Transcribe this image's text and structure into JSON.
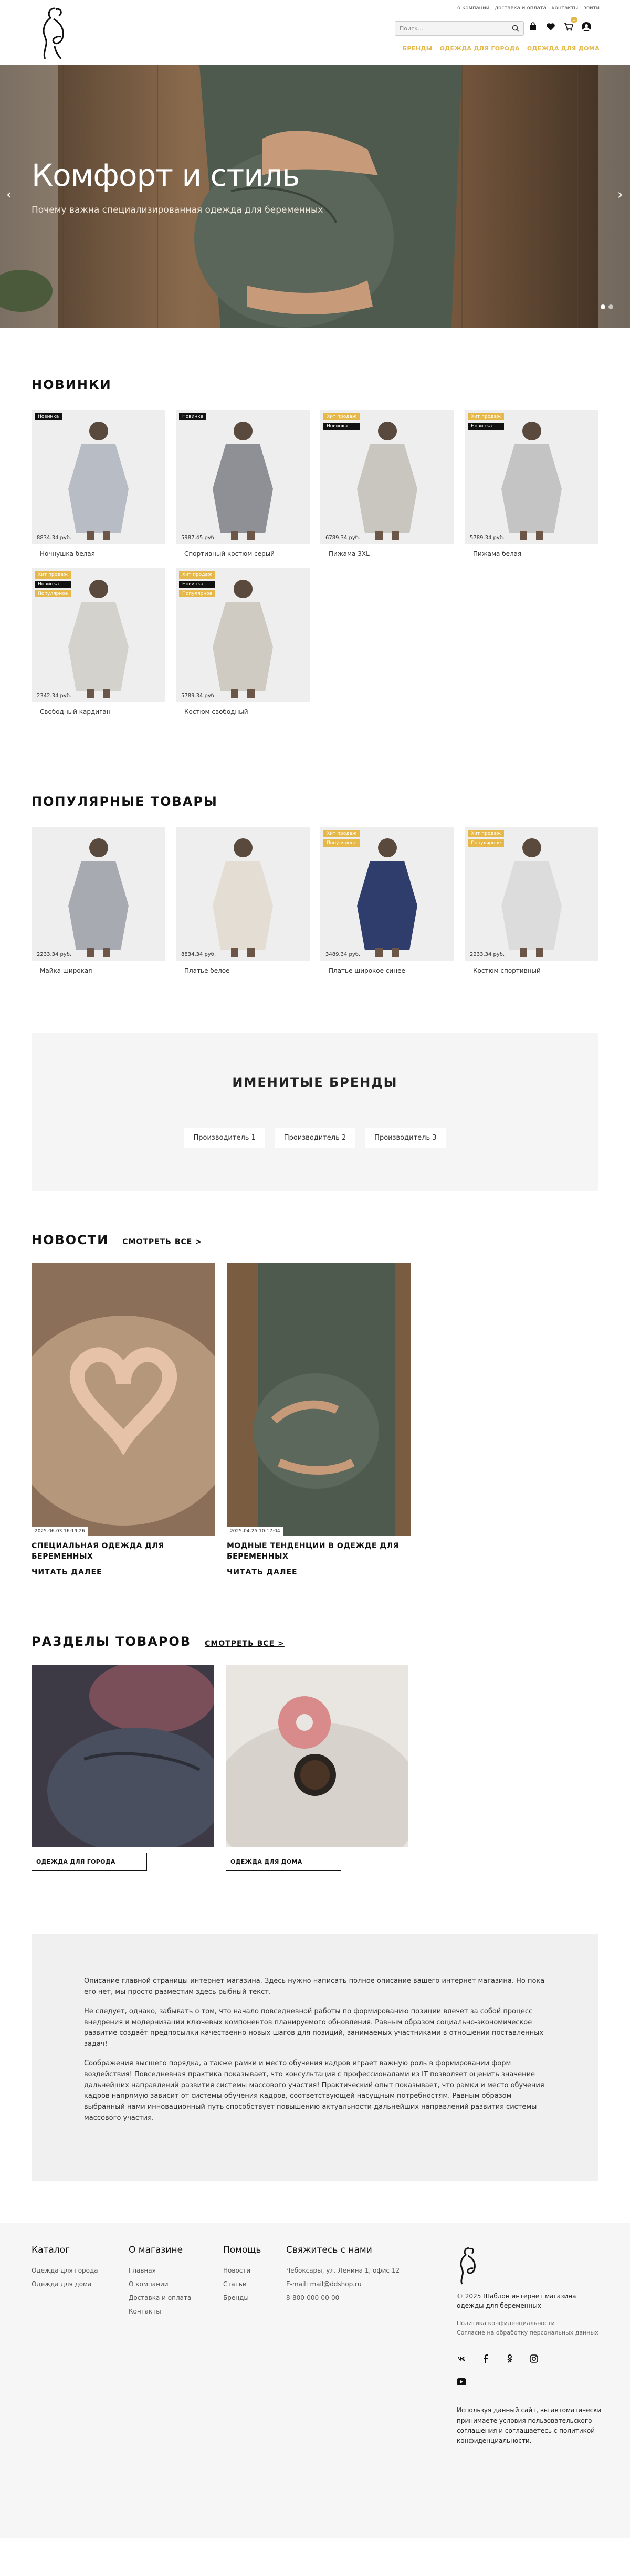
{
  "header": {
    "toplinks": [
      "о компании",
      "доставка и оплата",
      "контакты",
      "войти"
    ],
    "search_placeholder": "Поиск...",
    "cart_count": "1",
    "nav": [
      "БРЕНДЫ",
      "ОДЕЖДА ДЛЯ ГОРОДА",
      "ОДЕЖДА ДЛЯ ДОМА"
    ]
  },
  "hero": {
    "title": "Комфорт и стиль",
    "subtitle": "Почему важна специализированная одежда для беременных"
  },
  "new_section": {
    "title": "НОВИНКИ",
    "products": [
      {
        "name": "Ночнушка белая",
        "price": "8834.34 руб.",
        "tags": [
          "Новинка"
        ]
      },
      {
        "name": "Спортивный костюм серый",
        "price": "5987.45 руб.",
        "tags": [
          "Новинка"
        ]
      },
      {
        "name": "Пижама 3XL",
        "price": "6789.34 руб.",
        "tags": [
          "Хит продаж",
          "Новинка"
        ]
      },
      {
        "name": "Пижама белая",
        "price": "5789.34 руб.",
        "tags": [
          "Хит продаж",
          "Новинка"
        ]
      },
      {
        "name": "Свободный кардиган",
        "price": "2342.34 руб.",
        "tags": [
          "Хит продаж",
          "Новинка",
          "Популярное"
        ]
      },
      {
        "name": "Костюм свободный",
        "price": "5789.34 руб.",
        "tags": [
          "Хит продаж",
          "Новинка",
          "Популярное"
        ]
      }
    ]
  },
  "popular_section": {
    "title": "ПОПУЛЯРНЫЕ ТОВАРЫ",
    "products": [
      {
        "name": "Майка широкая",
        "price": "2233.34 руб.",
        "tags": []
      },
      {
        "name": "Платье белое",
        "price": "8834.34 руб.",
        "tags": []
      },
      {
        "name": "Платье широкое синее",
        "price": "3489.34 руб.",
        "tags": [
          "Хит продаж",
          "Популярное"
        ]
      },
      {
        "name": "Костюм спортивный",
        "price": "2233.34 руб.",
        "tags": [
          "Хит продаж",
          "Популярное"
        ]
      }
    ]
  },
  "brands": {
    "title": "ИМЕНИТЫЕ БРЕНДЫ",
    "items": [
      "Производитель 1",
      "Производитель 2",
      "Производитель 3"
    ]
  },
  "news": {
    "title": "НОВОСТИ",
    "all_link": "СМОТРЕТЬ ВСЕ >",
    "items": [
      {
        "date": "2025-06-03 16:19:26",
        "title": "СПЕЦИАЛЬНАЯ ОДЕЖДА ДЛЯ БЕРЕМЕННЫХ",
        "more": "ЧИТАТЬ ДАЛЕЕ"
      },
      {
        "date": "2025-04-25 10:17:04",
        "title": "МОДНЫЕ ТЕНДЕНЦИИ В ОДЕЖДЕ ДЛЯ БЕРЕМЕННЫХ",
        "more": "ЧИТАТЬ ДАЛЕЕ"
      }
    ]
  },
  "categories": {
    "title": "РАЗДЕЛЫ ТОВАРОВ",
    "all_link": "СМОТРЕТЬ ВСЕ >",
    "items": [
      {
        "label": "ОДЕЖДА ДЛЯ ГОРОДА"
      },
      {
        "label": "ОДЕЖДА ДЛЯ ДОМА"
      }
    ]
  },
  "description": {
    "paragraphs": [
      "Описание главной страницы интернет магазина. Здесь нужно написать полное описание вашего интернет магазина. Но пока его нет, мы просто разместим здесь рыбный текст.",
      "Не следует, однако, забывать о том, что начало повседневной работы по формированию позиции влечет за собой процесс внедрения и модернизации ключевых компонентов планируемого обновления. Равным образом социально-экономическое развитие создаёт предпосылки качественно новых шагов для позиций, занимаемых участниками в отношении поставленных задач!",
      "Соображения высшего порядка, а также рамки и место обучения кадров играет важную роль в формировании форм воздействия! Повседневная практика показывает, что консультация с профессионалами из IT позволяет оценить значение дальнейших направлений развития системы массового участия! Практический опыт показывает, что рамки и место обучения кадров напрямую зависит от системы обучения кадров, соответствующей насущным потребностям. Равным образом выбранный нами инновационный путь способствует повышению актуальности дальнейших направлений развития системы массового участия."
    ]
  },
  "footer": {
    "columns": [
      {
        "title": "Каталог",
        "links": [
          "Одежда для города",
          "Одежда для дома"
        ]
      },
      {
        "title": "О магазине",
        "links": [
          "Главная",
          "О компании",
          "Доставка и оплата",
          "Контакты"
        ]
      },
      {
        "title": "Помощь",
        "links": [
          "Новости",
          "Статьи",
          "Бренды"
        ]
      },
      {
        "title": "Свяжитесь с нами",
        "links": [
          "Чебоксары, ул. Ленина 1, офис 12",
          "E-mail: mail@ddshop.ru",
          "8-800-000-00-00"
        ]
      }
    ],
    "copyright": "© 2025 Шаблон интернет магазина одежды для беременных",
    "policy_links": [
      "Политика конфиденциальности",
      "Согласие на обработку персональных данных"
    ],
    "consent_text": "Используя данный сайт, вы автоматически принимаете условия пользовательского соглашения и соглашаетесь с политикой конфиденциальности."
  },
  "colors": {
    "accent": "#e6b84a",
    "dark": "#111111",
    "panel": "#f0f0f0"
  }
}
